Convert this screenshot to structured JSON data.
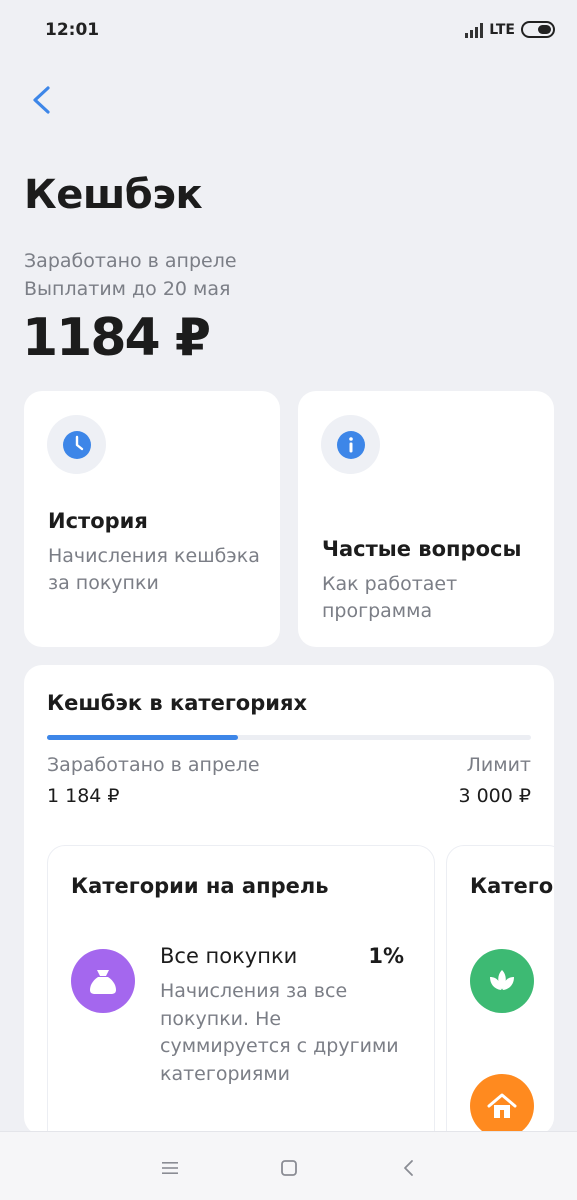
{
  "status_bar": {
    "time": "12:01",
    "network": "LTE"
  },
  "header": {
    "title": "Кешбэк"
  },
  "summary": {
    "earned_line": "Заработано в апреле",
    "payout_line": "Выплатим до 20 мая",
    "amount": "1184 ₽"
  },
  "quick_cards": {
    "history": {
      "title": "История",
      "subtitle": "Начисления кешбэка за покупки",
      "icon": "clock-icon"
    },
    "faq": {
      "title": "Частые вопросы",
      "subtitle": "Как работает программа",
      "icon": "info-icon"
    }
  },
  "categories_block": {
    "title": "Кешбэк в категориях",
    "progress_fraction": 0.395,
    "earned_label": "Заработано в апреле",
    "earned_value": "1 184 ₽",
    "limit_label": "Лимит",
    "limit_value": "3 000 ₽"
  },
  "category_cards": [
    {
      "title": "Категории на апрель",
      "items": [
        {
          "name": "Все покупки",
          "percent": "1%",
          "description": "Начисления за все покупки. Не суммируется с другими категориями",
          "icon": "bag-icon",
          "color": "#a467ee"
        }
      ]
    },
    {
      "title": "Катего",
      "items": [
        {
          "icon": "leaf-icon",
          "color": "#3dba73"
        },
        {
          "icon": "house-icon",
          "color": "#ff8a1f"
        }
      ]
    }
  ],
  "colors": {
    "accent": "#3d86e8",
    "background": "#eff0f4",
    "card": "#ffffff"
  }
}
